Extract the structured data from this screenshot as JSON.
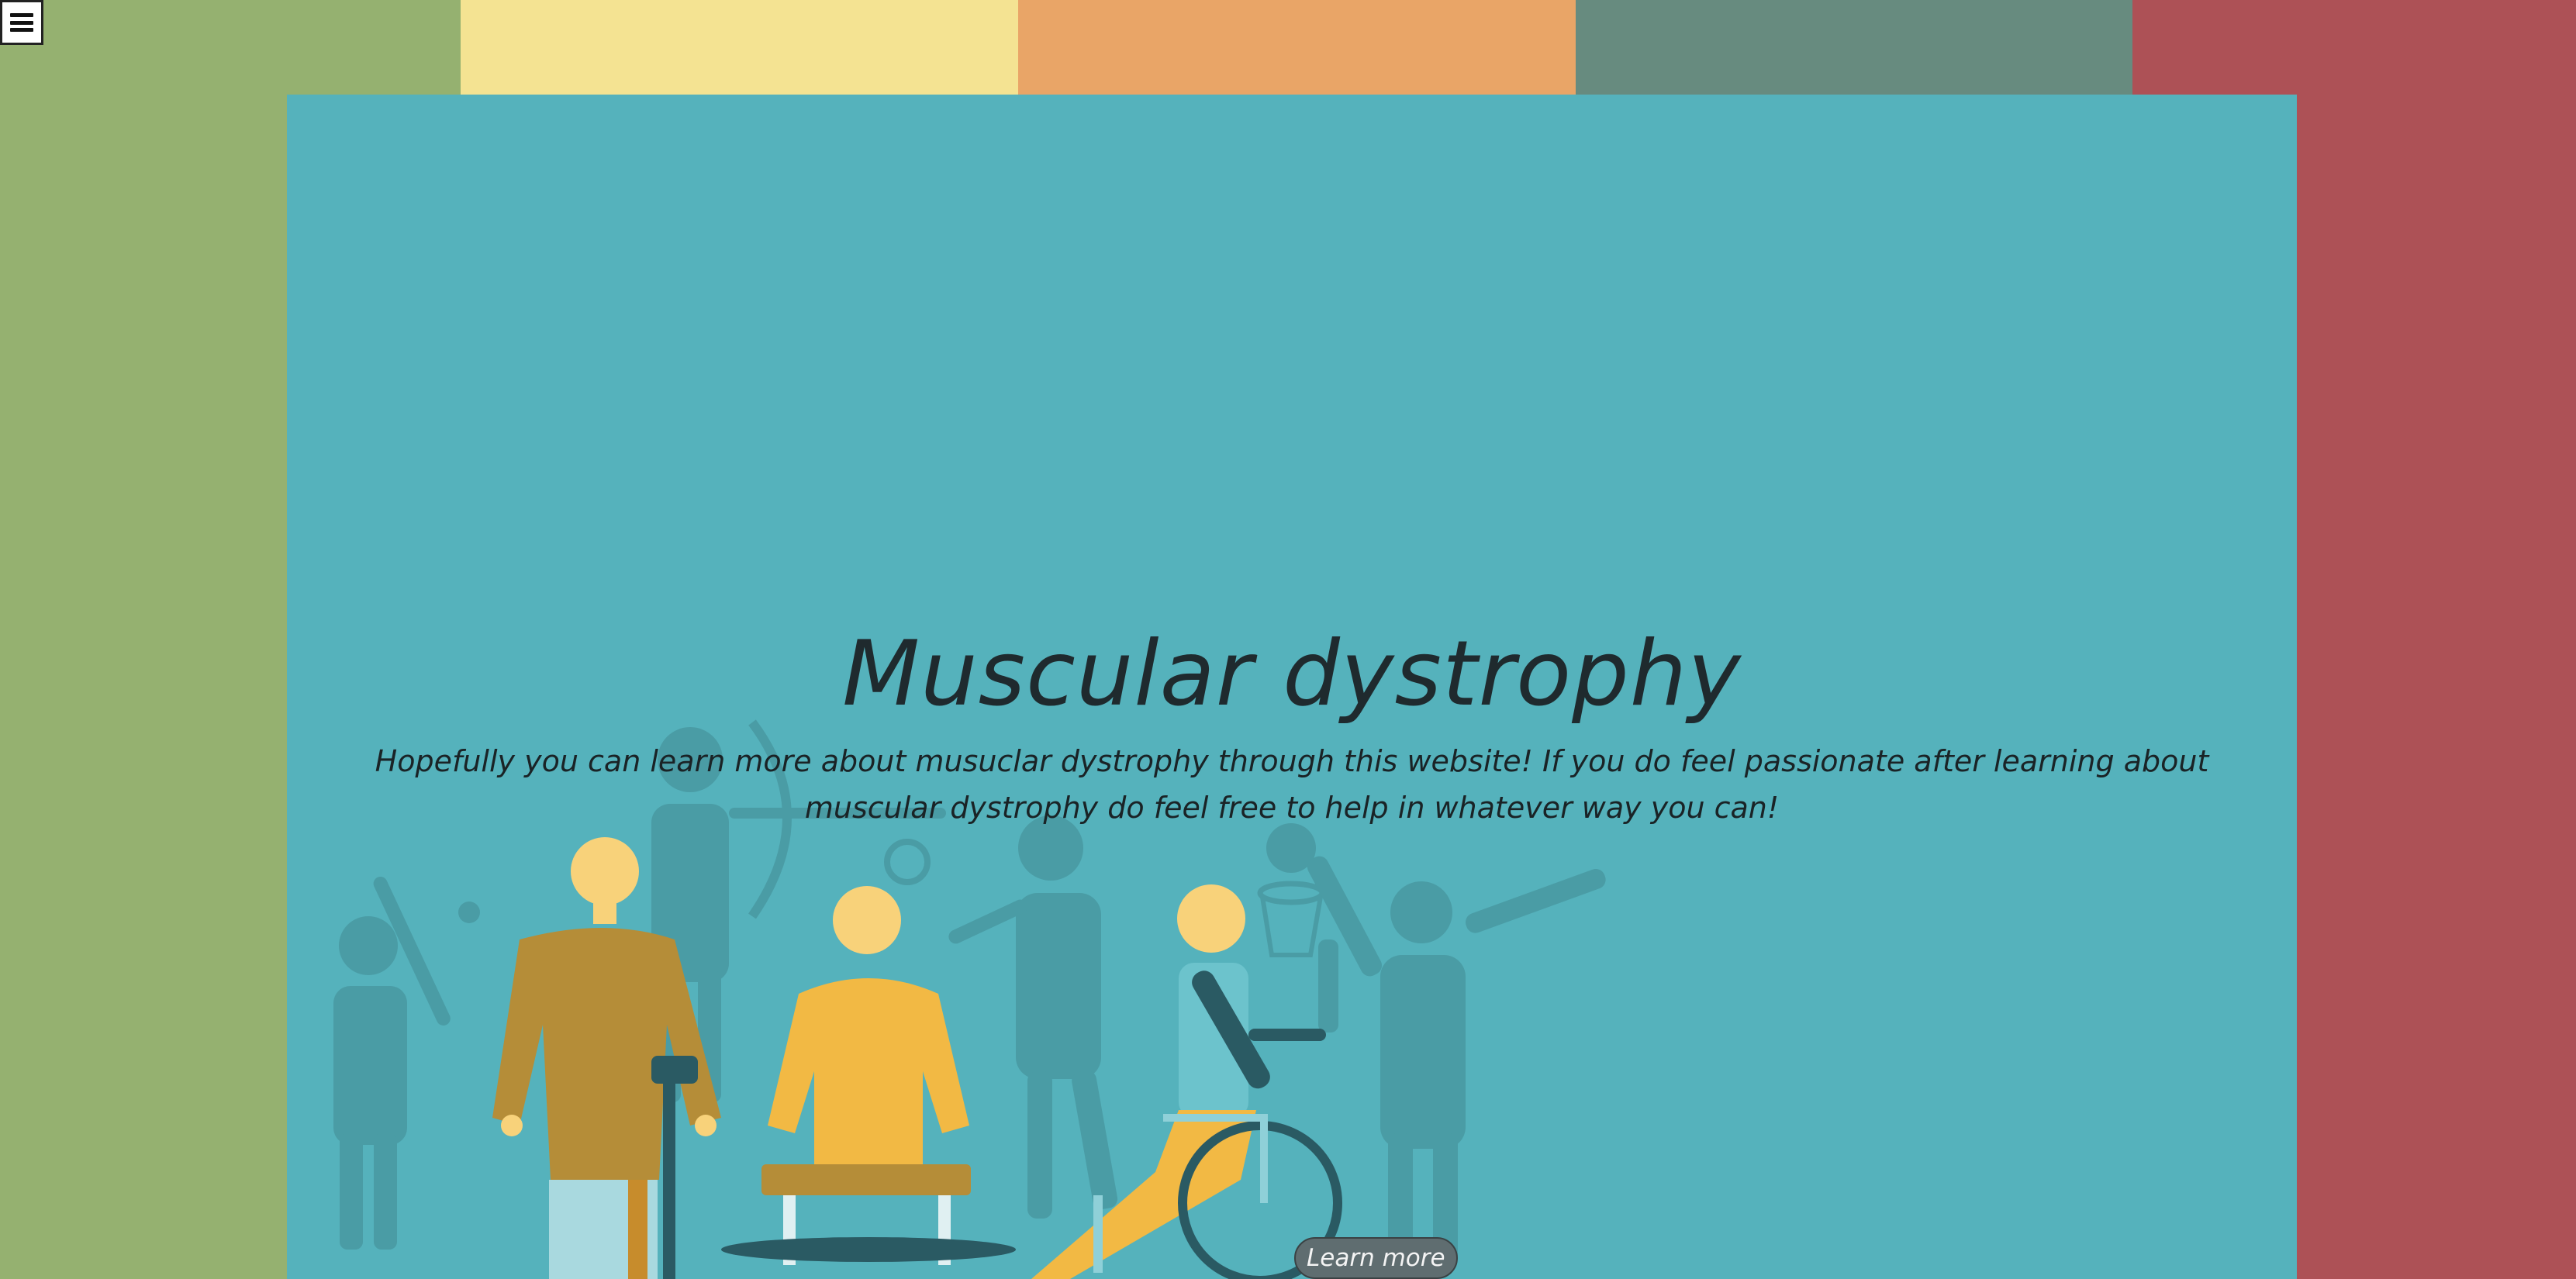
{
  "page": {
    "title": "Muscular dystrophy",
    "subtitle": "Hopefully you can learn more about musuclar dystrophy through this website! If you do feel passionate after learning about muscular dystrophy do feel free to help in whatever way you can!"
  },
  "nav": {
    "menu_icon": "hamburger-menu-icon"
  },
  "cta": {
    "learn_more_label": "Learn more"
  },
  "colors": {
    "stripe_green": "#95b170",
    "stripe_yellow": "#f4e392",
    "stripe_orange": "#e9a567",
    "stripe_slate": "#678b7f",
    "stripe_red": "#ad5156",
    "hero_teal": "#55b2bc"
  },
  "illustration": {
    "name": "people-with-disabilities-illustration"
  }
}
